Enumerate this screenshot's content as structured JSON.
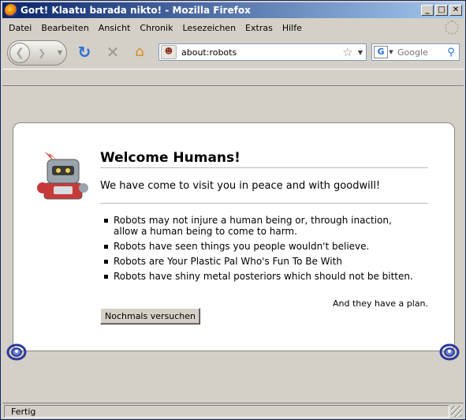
{
  "window": {
    "title": "Gort! Klaatu barada nikto! - Mozilla Firefox",
    "buttons": {
      "minimize": "_",
      "maximize": "□",
      "close": "✕"
    }
  },
  "menu": [
    {
      "label": "Datei"
    },
    {
      "label": "Bearbeiten"
    },
    {
      "label": "Ansicht"
    },
    {
      "label": "Chronik"
    },
    {
      "label": "Lesezeichen"
    },
    {
      "label": "Extras"
    },
    {
      "label": "Hilfe"
    }
  ],
  "navbar": {
    "url": "about:robots",
    "search_placeholder": "Google"
  },
  "page": {
    "title": "Welcome Humans!",
    "short_desc": "We have come to visit you in peace and with goodwill!",
    "items": [
      "Robots may not injure a human being or, through inaction, allow a human being to come to harm.",
      "Robots have seen things you people wouldn't believe.",
      "Robots are Your Plastic Pal Who's Fun To Be With",
      "Robots have shiny metal posteriors which should not be bitten."
    ],
    "plan": "And they have a plan.",
    "retry_label": "Nochmals versuchen"
  },
  "status": {
    "text": "Fertig"
  },
  "colors": {
    "chrome": "#d4d0c8",
    "titlebar_start": "#0a246a",
    "titlebar_end": "#a6caf0",
    "link_blue": "#2a6ed8"
  }
}
